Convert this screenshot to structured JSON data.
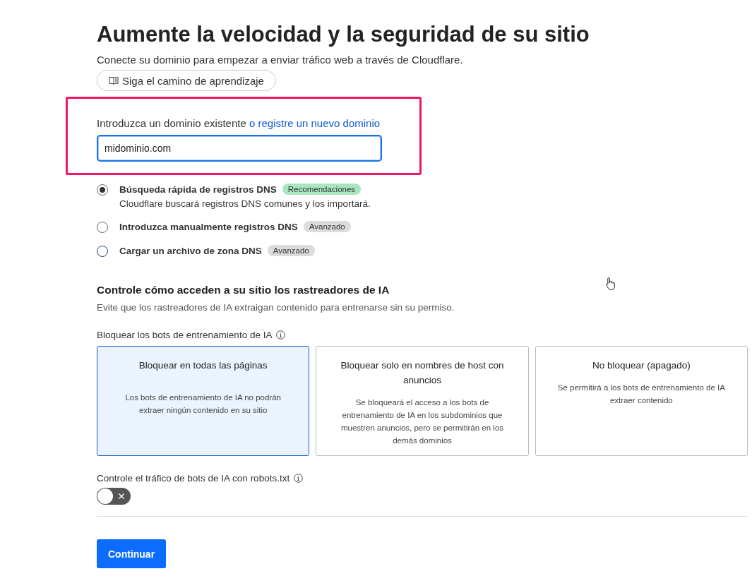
{
  "title": "Aumente la velocidad y la seguridad de su sitio",
  "subtitle": "Conecte su dominio para empezar a enviar tráfico web a través de Cloudflare.",
  "learning_button": "Siga el camino de aprendizaje",
  "domain": {
    "label": "Introduzca un dominio existente",
    "link": "o registre un nuevo dominio",
    "value": "midominio.com"
  },
  "dns_options": [
    {
      "label": "Búsqueda rápida de registros DNS",
      "badge": {
        "text": "Recomendaciones",
        "color": "#a8e6bf"
      },
      "description": "Cloudflare buscará registros DNS comunes y los importará.",
      "selected": true
    },
    {
      "label": "Introduzca manualmente registros DNS",
      "badge": {
        "text": "Avanzado",
        "color": "#dcdcdc"
      },
      "selected": false
    },
    {
      "label": "Cargar un archivo de zona DNS",
      "badge": {
        "text": "Avanzado",
        "color": "#dcdcdc"
      },
      "selected": false
    }
  ],
  "ai_section": {
    "title": "Controle cómo acceden a su sitio los rastreadores de IA",
    "description": "Evite que los rastreadores de IA extraigan contenido para entrenarse sin su permiso.",
    "block_label": "Bloquear los bots de entrenamiento de IA",
    "cards": [
      {
        "title": "Bloquear en todas las páginas",
        "description": "Los bots de entrenamiento de IA no podrán extraer ningún contenido en su sitio",
        "selected": true
      },
      {
        "title": "Bloquear solo en nombres de host con anuncios",
        "description": "Se bloqueará el acceso a los bots de entrenamiento de IA en los subdominios que muestren anuncios, pero se permitirán en los demás dominios",
        "selected": false
      },
      {
        "title": "No bloquear (apagado)",
        "description": "Se permitirá a los bots de entrenamiento de IA extraer contenido",
        "selected": false
      }
    ],
    "robots_label": "Controle el tráfico de bots de IA con robots.txt",
    "robots_toggle": {
      "on": false
    }
  },
  "continue_button": "Continuar"
}
